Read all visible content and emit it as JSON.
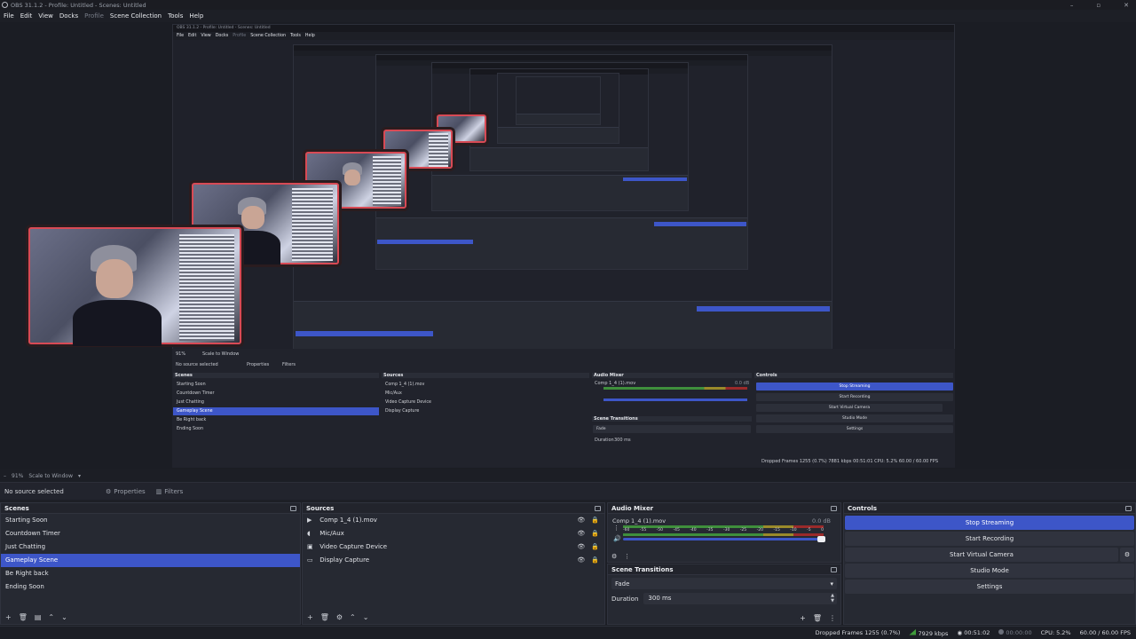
{
  "window": {
    "title": "OBS 31.1.2 - Profile: Untitled - Scenes: Untitled",
    "minimize": "–",
    "maximize": "▫",
    "close": "✕"
  },
  "menu": [
    "File",
    "Edit",
    "View",
    "Docks",
    "Profile",
    "Scene Collection",
    "Tools",
    "Help"
  ],
  "inner": {
    "title": "OBS 31.1.2 - Profile: Untitled - Scenes: Untitled",
    "no_source": "No source selected",
    "properties": "Properties",
    "filters": "Filters",
    "scenes_title": "Scenes",
    "sources_title": "Sources",
    "mixer_title": "Audio Mixer",
    "controls_title": "Controls",
    "transitions_title": "Scene Transitions",
    "track": "Comp 1_4 (1).mov",
    "db": "0.0 dB",
    "fade": "Fade",
    "duration_label": "Duration",
    "duration_value": "300 ms",
    "zoom": "91%",
    "scale": "Scale to Window",
    "status": "Dropped Frames 1255 (0.7%)   7881 kbps   00:51:01   CPU: 5.2%   60.00 / 60.00 FPS"
  },
  "scale_bar": {
    "zoom": "91%",
    "scale": "Scale to Window",
    "minus": "–"
  },
  "props_bar": {
    "no_source": "No source selected",
    "properties": "Properties",
    "filters": "Filters"
  },
  "scenes": {
    "title": "Scenes",
    "items": [
      "Starting Soon",
      "Countdown Timer",
      "Just Chatting",
      "Gameplay Scene",
      "Be Right back",
      "Ending Soon"
    ],
    "selected_index": 3
  },
  "sources": {
    "title": "Sources",
    "items": [
      {
        "label": "Comp 1_4 (1).mov",
        "icon": "play-icon"
      },
      {
        "label": "Mic/Aux",
        "icon": "mic-icon"
      },
      {
        "label": "Video Capture Device",
        "icon": "camera-icon"
      },
      {
        "label": "Display Capture",
        "icon": "monitor-icon"
      }
    ]
  },
  "mixer": {
    "title": "Audio Mixer",
    "track": "Comp 1_4 (1).mov",
    "db": "0.0 dB",
    "ticks": [
      "-60",
      "-55",
      "-50",
      "-45",
      "-40",
      "-35",
      "-30",
      "-25",
      "-20",
      "-15",
      "-10",
      "-5",
      "0"
    ],
    "volume_fraction": 1.0
  },
  "transitions": {
    "title": "Scene Transitions",
    "selected": "Fade",
    "duration_label": "Duration",
    "duration_value": "300 ms"
  },
  "controls": {
    "title": "Controls",
    "stop_streaming": "Stop Streaming",
    "start_recording": "Start Recording",
    "start_virtual_camera": "Start Virtual Camera",
    "studio_mode": "Studio Mode",
    "settings": "Settings"
  },
  "status": {
    "dropped": "Dropped Frames 1255 (0.7%)",
    "bitrate": "7929 kbps",
    "stream_time": "00:51:02",
    "rec_time": "00:00:00",
    "cpu": "CPU: 5.2%",
    "fps": "60.00 / 60.00 FPS"
  },
  "colors": {
    "accent": "#3d56c8",
    "bg": "#1d1f26",
    "panel": "#262932",
    "webcam_border": "#d84a55"
  }
}
